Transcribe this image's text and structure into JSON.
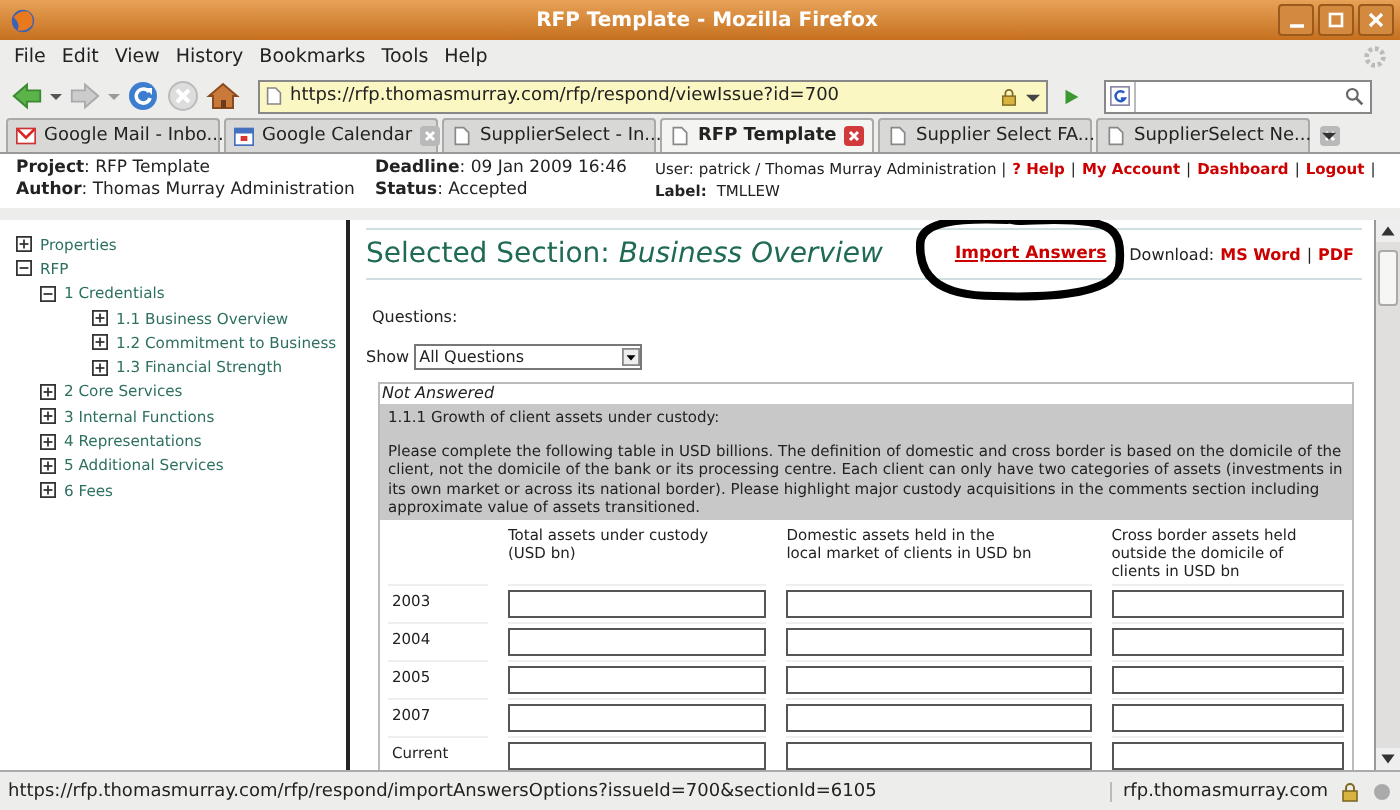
{
  "window": {
    "title": "RFP Template - Mozilla Firefox"
  },
  "menu": [
    "File",
    "Edit",
    "View",
    "History",
    "Bookmarks",
    "Tools",
    "Help"
  ],
  "toolbar": {
    "url": "https://rfp.thomasmurray.com/rfp/respond/viewIssue?id=700"
  },
  "tabs": [
    {
      "label": "Google Mail - Inbo...",
      "kind": "mail",
      "selected": false
    },
    {
      "label": "Google Calendar",
      "kind": "calendar",
      "selected": false
    },
    {
      "label": "SupplierSelect - In...",
      "kind": "page",
      "selected": false
    },
    {
      "label": "RFP Template",
      "kind": "page",
      "selected": true
    },
    {
      "label": "Supplier Select FA...",
      "kind": "page",
      "selected": false
    },
    {
      "label": "SupplierSelect Ne...",
      "kind": "page",
      "selected": false
    }
  ],
  "header": {
    "fields": [
      {
        "label": "Project",
        "value": ": RFP Template"
      },
      {
        "label": "Author",
        "value": ": Thomas Murray Administration"
      }
    ],
    "dates": [
      {
        "label": "Deadline",
        "value": ": 09 Jan 2009 16:46"
      },
      {
        "label": "Status",
        "value": ": Accepted"
      }
    ],
    "user": "User: patrick / Thomas Murray Administration |",
    "links": [
      {
        "label": "? Help",
        "separator": "|"
      },
      {
        "label": "My Account",
        "separator": "|"
      },
      {
        "label": "Dashboard",
        "separator": "|"
      },
      {
        "label": "Logout",
        "separator": "|"
      }
    ],
    "label_name": "Label:",
    "label_value": "TMLLEW"
  },
  "sidebar": {
    "items": [
      {
        "label": "Properties",
        "expanded": false
      },
      {
        "label": "RFP",
        "expanded": true,
        "children": [
          {
            "label": "1 Credentials",
            "expanded": true,
            "children": [
              {
                "label": "1.1 Business Overview",
                "expanded": false
              },
              {
                "label": "1.2 Commitment to Business",
                "expanded": false
              },
              {
                "label": "1.3 Financial Strength",
                "expanded": false
              }
            ]
          },
          {
            "label": "2 Core Services",
            "expanded": false
          },
          {
            "label": "3 Internal Functions",
            "expanded": false
          },
          {
            "label": "4 Representations",
            "expanded": false
          },
          {
            "label": "5 Additional Services",
            "expanded": false
          },
          {
            "label": "6 Fees",
            "expanded": false
          }
        ]
      }
    ]
  },
  "section": {
    "heading": "Selected Section:",
    "name": "Business Overview",
    "import_link": "Import Answers",
    "download_label": "Download:",
    "downloads": [
      "MS Word",
      "PDF"
    ],
    "download_separator": "|"
  },
  "questions_label": "Questions:",
  "show": {
    "label": "Show",
    "value": "All Questions"
  },
  "question": {
    "status": "Not Answered",
    "title": "1.1.1 Growth of client assets under custody:",
    "description": "Please complete the following table in USD billions. The definition of domestic and cross border is based on the domicile of the client, not the domicile of the bank or its processing centre. Each client can only have two categories of assets (investments in its own market or across its national border). Please highlight major custody acquisitions in the comments section including approximate value of assets transitioned.",
    "columns": [
      "Total assets under custody\n(USD bn)",
      "Domestic assets held in the\nlocal market of clients in USD bn",
      "Cross border assets held\noutside the domicile of\nclients in USD bn"
    ],
    "rows": [
      "2003",
      "2004",
      "2005",
      "2007",
      "Current"
    ]
  },
  "status_bar": {
    "url": "https://rfp.thomasmurray.com/rfp/respond/importAnswersOptions?issueId=700&sectionId=6105",
    "host": "rfp.thomasmurray.com"
  }
}
